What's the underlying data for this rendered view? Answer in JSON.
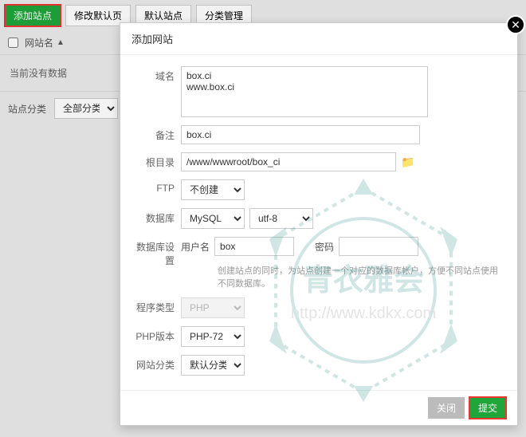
{
  "toolbar": {
    "add_site": "添加站点",
    "edit_default": "修改默认页",
    "default_site": "默认站点",
    "category_mgmt": "分类管理"
  },
  "table": {
    "col_name": "网站名",
    "empty_text": "当前没有数据",
    "filter_label": "站点分类",
    "filter_all": "全部分类"
  },
  "dialog": {
    "title": "添加网站",
    "domain_label": "域名",
    "domain_value": "box.ci\nwww.box.ci",
    "note_label": "备注",
    "note_value": "box.ci",
    "root_label": "根目录",
    "root_value": "/www/wwwroot/box_ci",
    "ftp_label": "FTP",
    "ftp_value": "不创建",
    "db_label": "数据库",
    "db_type": "MySQL",
    "db_charset": "utf-8",
    "db_settings_label": "数据库设置",
    "db_user_label": "用户名",
    "db_user_value": "box",
    "db_pass_label": "密码",
    "db_hint": "创建站点的同时，为站点创建一个对应的数据库帐户，方便不同站点使用不同数据库。",
    "program_label": "程序类型",
    "program_value": "PHP",
    "phpver_label": "PHP版本",
    "phpver_value": "PHP-72",
    "category_label": "网站分类",
    "category_value": "默认分类",
    "close_btn": "关闭",
    "submit_btn": "提交"
  },
  "watermark": {
    "text_main": "青衣雅会",
    "text_url": "http://www.kdkx.com"
  }
}
